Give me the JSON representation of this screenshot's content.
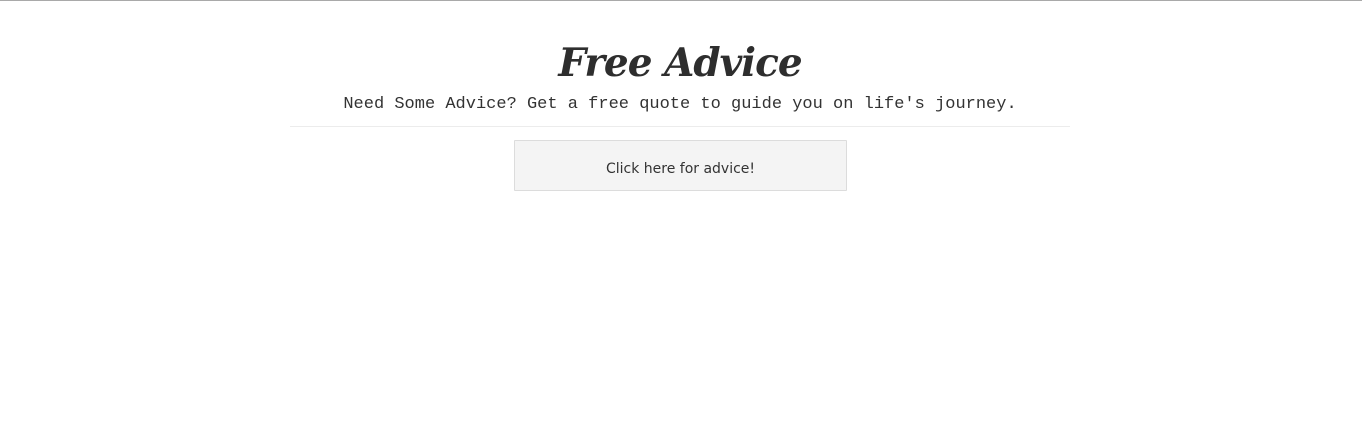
{
  "header": {
    "title": "Free Advice",
    "subtitle": "Need Some Advice? Get a free quote to guide you on life's journey."
  },
  "main": {
    "advice_button_label": "Click here for advice!"
  }
}
